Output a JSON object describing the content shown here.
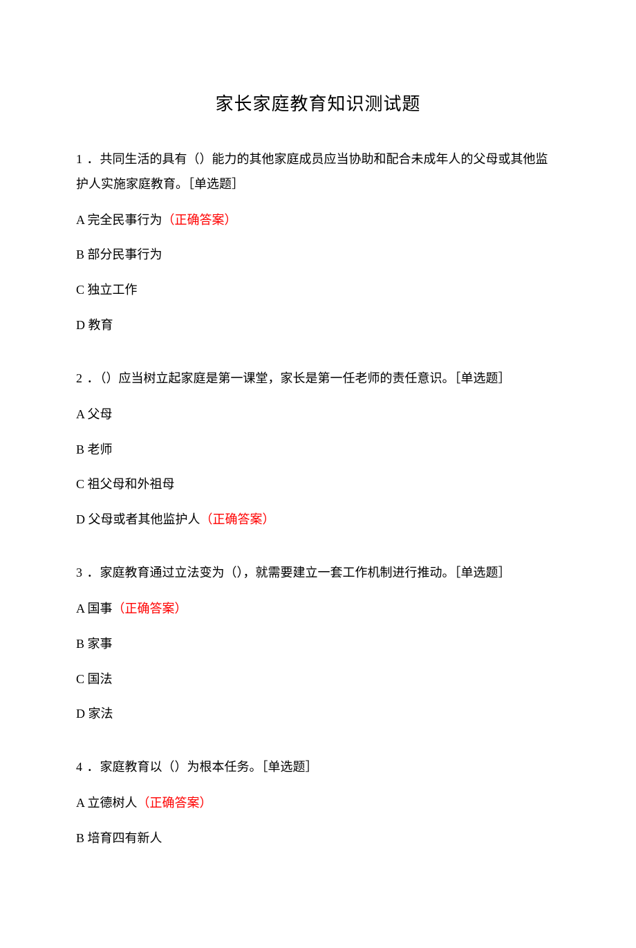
{
  "title": "家长家庭教育知识测试题",
  "correctLabel": "（正确答案）",
  "questions": [
    {
      "number": "1 ．",
      "text": "共同生活的具有（）能力的其他家庭成员应当协助和配合未成年人的父母或其他监护人实施家庭教育。［单选题］",
      "options": [
        {
          "label": "A 完全民事行为",
          "correct": true
        },
        {
          "label": "B 部分民事行为",
          "correct": false
        },
        {
          "label": "C 独立工作",
          "correct": false
        },
        {
          "label": "D 教育",
          "correct": false
        }
      ]
    },
    {
      "number": "2 ．",
      "text": "（）应当树立起家庭是第一课堂，家长是第一任老师的责任意识。［单选题］",
      "options": [
        {
          "label": "A 父母",
          "correct": false
        },
        {
          "label": "B 老师",
          "correct": false
        },
        {
          "label": "C 祖父母和外祖母",
          "correct": false
        },
        {
          "label": "D 父母或者其他监护人",
          "correct": true
        }
      ]
    },
    {
      "number": "3 ．",
      "text": "家庭教育通过立法变为（），就需要建立一套工作机制进行推动。［单选题］",
      "options": [
        {
          "label": "A 国事",
          "correct": true
        },
        {
          "label": "B 家事",
          "correct": false
        },
        {
          "label": "C 国法",
          "correct": false
        },
        {
          "label": "D 家法",
          "correct": false
        }
      ]
    },
    {
      "number": "4 ．",
      "text": "家庭教育以（）为根本任务。［单选题］",
      "options": [
        {
          "label": "A 立德树人",
          "correct": true
        },
        {
          "label": "B 培育四有新人",
          "correct": false
        }
      ]
    }
  ]
}
